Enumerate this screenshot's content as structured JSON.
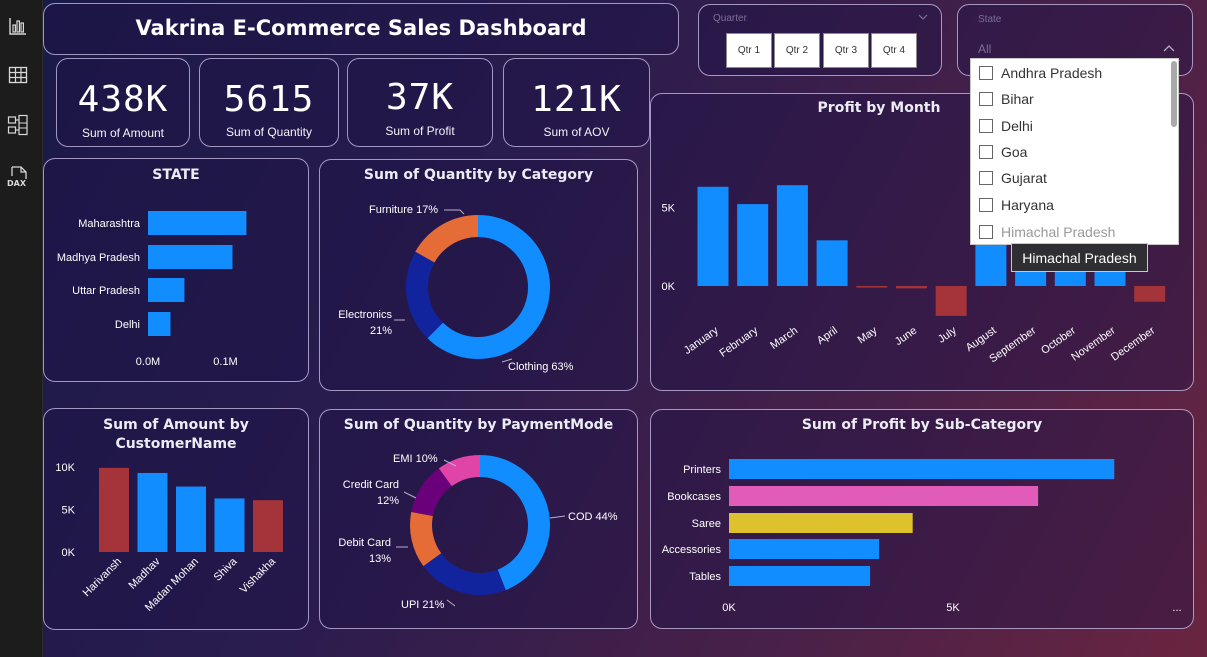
{
  "header": {
    "title": "Vakrina E-Commerce Sales Dashboard"
  },
  "nav": {
    "icons": [
      "report-view-icon",
      "table-view-icon",
      "model-view-icon",
      "dax-query-icon"
    ],
    "dax_label": "DAX"
  },
  "kpis": [
    {
      "value": "438K",
      "label": "Sum of Amount"
    },
    {
      "value": "5615",
      "label": "Sum of Quantity"
    },
    {
      "value": "37K",
      "label": "Sum of Profit"
    },
    {
      "value": "121K",
      "label": "Sum of AOV"
    }
  ],
  "quarter_slicer": {
    "header": "Quarter",
    "buttons": [
      "Qtr 1",
      "Qtr 2",
      "Qtr 3",
      "Qtr 4"
    ]
  },
  "state_slicer": {
    "header": "State",
    "selected": "All",
    "options": [
      "Andhra Pradesh",
      "Bihar",
      "Delhi",
      "Goa",
      "Gujarat",
      "Haryana",
      "Himachal Pradesh"
    ],
    "tooltip": "Himachal Pradesh"
  },
  "chart_data": [
    {
      "id": "state",
      "type": "bar",
      "orientation": "horizontal",
      "title": "STATE",
      "categories": [
        "Maharashtra",
        "Madhya Pradesh",
        "Uttar Pradesh",
        "Delhi"
      ],
      "values": [
        0.127,
        0.109,
        0.047,
        0.029
      ],
      "x_ticks": [
        "0.0M",
        "0.1M"
      ],
      "xlim": [
        0,
        0.1795
      ],
      "color": "#118DFF"
    },
    {
      "id": "qty-category",
      "type": "pie",
      "donut": true,
      "title": "Sum of Quantity by Category",
      "slices": [
        {
          "label": "Clothing",
          "pct": "63%",
          "value": 63,
          "color": "#118DFF"
        },
        {
          "label": "Electronics",
          "pct": "21%",
          "value": 21,
          "color": "#12239E"
        },
        {
          "label": "Furniture",
          "pct": "17%",
          "value": 17,
          "color": "#E66C37"
        }
      ]
    },
    {
      "id": "profit-month",
      "type": "bar",
      "title": "Profit by Month",
      "categories": [
        "January",
        "February",
        "March",
        "April",
        "May",
        "June",
        "July",
        "August",
        "September",
        "October",
        "November",
        "December"
      ],
      "values": [
        6300,
        5200,
        6400,
        2900,
        -100,
        -150,
        -1900,
        4000,
        4000,
        4000,
        4000,
        -1000
      ],
      "y_ticks": [
        {
          "value": 5000,
          "label": "5K"
        },
        {
          "value": 0,
          "label": "0K"
        }
      ],
      "ylim": [
        -3500,
        8000
      ],
      "positive_color": "#118DFF",
      "negative_color": "#A4343A"
    },
    {
      "id": "amount-customer",
      "type": "bar",
      "title": "Sum of Amount by CustomerName",
      "categories": [
        "Harivansh",
        "Madhav",
        "Madan Mohan",
        "Shiva",
        "Vishakha"
      ],
      "values": [
        9900,
        9300,
        7700,
        6300,
        6100
      ],
      "colors": [
        "#A4343A",
        "#118DFF",
        "#118DFF",
        "#118DFF",
        "#A4343A"
      ],
      "y_ticks": [
        {
          "value": 10000,
          "label": "10K"
        },
        {
          "value": 5000,
          "label": "5K"
        },
        {
          "value": 0,
          "label": "0K"
        }
      ],
      "ylim": [
        0,
        10000
      ]
    },
    {
      "id": "qty-payment",
      "type": "pie",
      "donut": true,
      "title": "Sum of Quantity by PaymentMode",
      "slices": [
        {
          "label": "COD",
          "pct": "44%",
          "value": 44,
          "color": "#118DFF"
        },
        {
          "label": "UPI",
          "pct": "21%",
          "value": 21,
          "color": "#12239E"
        },
        {
          "label": "Debit Card",
          "pct": "13%",
          "value": 13,
          "color": "#E66C37"
        },
        {
          "label": "Credit Card",
          "pct": "12%",
          "value": 12,
          "color": "#6B007B"
        },
        {
          "label": "EMI",
          "pct": "10%",
          "value": 10,
          "color": "#E044A7"
        }
      ]
    },
    {
      "id": "profit-subcategory",
      "type": "bar",
      "orientation": "horizontal",
      "title": "Sum of Profit by Sub-Category",
      "categories": [
        "Printers",
        "Bookcases",
        "Saree",
        "Accessories",
        "Tables"
      ],
      "values": [
        8600,
        6900,
        4100,
        3350,
        3150
      ],
      "colors": [
        "#118DFF",
        "#E15BB8",
        "#DDC22E",
        "#118DFF",
        "#118DFF"
      ],
      "x_ticks": [
        {
          "value": 0,
          "label": "0K"
        },
        {
          "value": 5000,
          "label": "5K"
        }
      ],
      "xlim": [
        0,
        9300
      ],
      "more_label": "..."
    }
  ]
}
